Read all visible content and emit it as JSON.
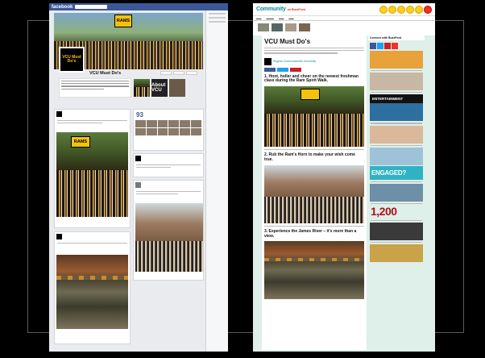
{
  "facebook": {
    "logo": "facebook",
    "page_name": "VCU Must Do's",
    "profile_text": "VCU Must Do's",
    "cover_sign": "RAMS",
    "about_tile": "About VCU",
    "likes_count": "93",
    "post_sign": "RAMS",
    "colors": {
      "brand": "#3b5998",
      "accent": "#f4c20d"
    }
  },
  "buzzfeed": {
    "logo": "Community",
    "logo_badge": "on BuzzFeed",
    "title": "VCU Must Do's",
    "author": "Virginia Commonwealth University",
    "headings": [
      "1. Hoot, holler and cheer on the newest freshman class during the Ram Spirit Walk.",
      "2. Rub the Ram's Horn to make your wish come true.",
      "3. Experience the James River – it's more than a view."
    ],
    "rail": {
      "connect": "Connect with BuzzFeed",
      "big_number": "1,200",
      "engaged": "ENGAGED?",
      "entertainment": "ENTERTAINMENT"
    },
    "colors": {
      "brand": "#0a8fa0",
      "badge": "#f7d117",
      "alert": "#ee3322"
    }
  }
}
